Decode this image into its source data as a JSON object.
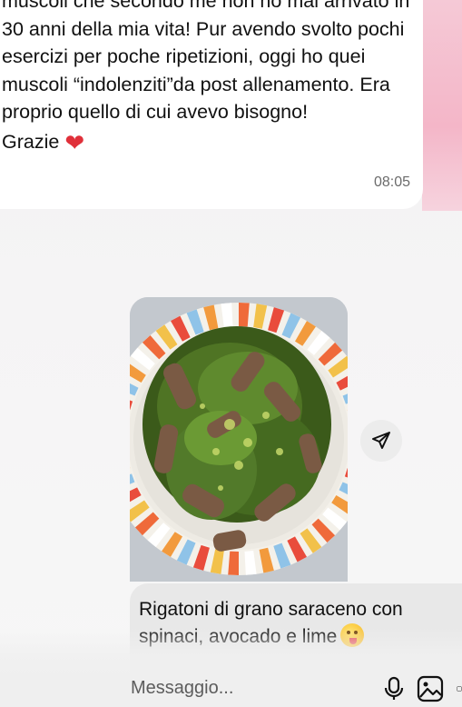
{
  "conversation": {
    "incoming_message": {
      "text": "muscoli che secondo me non ho mai arrivato in 30 anni della mia vita! Pur avendo svolto pochi esercizi per poche ripetizioni, oggi ho quei muscoli “indolenziti”da post allenamento. Era proprio quello di cui avevo bisogno!\nGrazie",
      "emoji": "red-heart",
      "time": "08:05"
    },
    "outgoing_photo": {
      "subject": "plate of buckwheat rigatoni with spinach"
    },
    "outgoing_caption": {
      "text": "Rigatoni di grano saraceno con spinaci, avocado e lime",
      "emoji": "face-savoring-food"
    }
  },
  "composer": {
    "placeholder": "Messaggio..."
  },
  "colors": {
    "accent_pink": "#f4b6c8",
    "heart_red": "#e0303a",
    "bubble_white": "#ffffff",
    "bubble_gray": "#e8e8e8"
  }
}
